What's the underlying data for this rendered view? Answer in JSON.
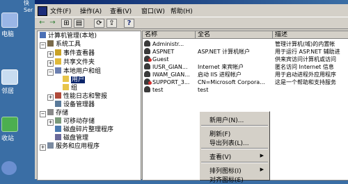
{
  "desktop": {
    "icons": [
      {
        "label": "电脑",
        "color": "#9ab6e6"
      },
      {
        "label": "邻居",
        "color": "#c8dcf0"
      },
      {
        "label": "收站",
        "color": "#4caf50"
      },
      {
        "label": "",
        "color": "#6b8fd0"
      }
    ],
    "strip_text": "快\nSer"
  },
  "window": {
    "menu": [
      "文件(F)",
      "操作(A)",
      "查看(V)",
      "窗口(W)",
      "帮助(H)"
    ],
    "toolbar": [
      "←",
      "→",
      "⊞",
      "▤",
      "⟳",
      "⇪",
      "?"
    ]
  },
  "tree": {
    "items": [
      {
        "label": "计算机管理(本地)",
        "icon": "computer-icon"
      },
      {
        "label": "系统工具",
        "icon": "tools-icon"
      },
      {
        "label": "事件查看器",
        "icon": "event-viewer-icon"
      },
      {
        "label": "共享文件夹",
        "icon": "shared-folder-icon"
      },
      {
        "label": "本地用户和组",
        "icon": "users-groups-icon"
      },
      {
        "label": "用户",
        "icon": "folder-icon"
      },
      {
        "label": "组",
        "icon": "folder-icon"
      },
      {
        "label": "性能日志和警报",
        "icon": "performance-icon"
      },
      {
        "label": "设备管理器",
        "icon": "device-manager-icon"
      },
      {
        "label": "存储",
        "icon": "storage-icon"
      },
      {
        "label": "可移动存储",
        "icon": "removable-storage-icon"
      },
      {
        "label": "磁盘碎片整理程序",
        "icon": "defrag-icon"
      },
      {
        "label": "磁盘管理",
        "icon": "disk-management-icon"
      },
      {
        "label": "服务和应用程序",
        "icon": "services-icon"
      }
    ]
  },
  "list": {
    "columns": [
      "名称",
      "全名",
      "描述"
    ],
    "rows": [
      {
        "name": "Administr...",
        "full": "",
        "desc": "管理计算机(域)的内置帐",
        "disabled": false
      },
      {
        "name": "ASPNET",
        "full": "ASP.NET 计算机帐户",
        "desc": "用于运行 ASP.NET 辅助进",
        "disabled": false
      },
      {
        "name": "Guest",
        "full": "",
        "desc": "供来宾访问计算机或访问",
        "disabled": true
      },
      {
        "name": "IUSR_GIAN...",
        "full": "Internet 来宾帐户",
        "desc": "匿名访问 Internet 信息",
        "disabled": false
      },
      {
        "name": "IWAM_GIAN...",
        "full": "启动 IIS 进程帐户",
        "desc": "用于启动进程外应用程序",
        "disabled": false
      },
      {
        "name": "SUPPORT_3...",
        "full": "CN=Microsoft Corpora...",
        "desc": "这是一个帮助和支持服务",
        "disabled": true
      },
      {
        "name": "test",
        "full": "test",
        "desc": "",
        "disabled": false
      }
    ]
  },
  "context_menu": {
    "new_user": "新用户(N)...",
    "refresh": "刷新(F)",
    "export": "导出列表(L)...",
    "view": "查看(V)",
    "arrange": "排列图标(I)",
    "lineup": "对齐图标(E)"
  }
}
